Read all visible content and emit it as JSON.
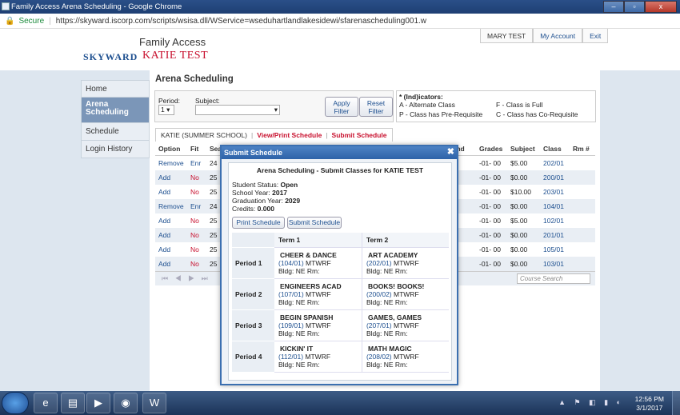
{
  "window": {
    "title": "Family Access Arena Scheduling - Google Chrome",
    "min": "–",
    "max": "▫",
    "close": "x"
  },
  "address": {
    "secure": "Secure",
    "url": "https://skyward.iscorp.com/scripts/wsisa.dll/WService=wseduhartlandlakesidewi/sfarenascheduling001.w"
  },
  "header": {
    "logo": "SKYWARD",
    "app_name": "Family Access",
    "student_name": "KATIE TEST",
    "user": "MARY TEST",
    "my_account": "My Account",
    "exit": "Exit"
  },
  "sidebar": {
    "items": [
      {
        "label": "Home"
      },
      {
        "label": "Arena Scheduling"
      },
      {
        "label": "Schedule"
      },
      {
        "label": "Login History"
      }
    ]
  },
  "page": {
    "title": "Arena Scheduling"
  },
  "filter": {
    "period_label": "Period:",
    "period_value": "1",
    "subject_label": "Subject:",
    "subject_value": "",
    "apply": "Apply Filter",
    "reset": "Reset Filter"
  },
  "indicators": {
    "title": "* (Ind)icators:",
    "a": "A - Alternate Class",
    "f": "F - Class is Full",
    "p": "P - Class has Pre-Requisite",
    "c": "C - Class has Co-Requisite"
  },
  "tabs": {
    "student": "KATIE (SUMMER SCHOOL)",
    "view_print": "View/Print Schedule",
    "separator": "|",
    "submit": "Submit Schedule"
  },
  "grid": {
    "headers": {
      "option": "Option",
      "fit": "Fit",
      "seats": "Sea",
      "ind": "Ind",
      "grades": "Grades",
      "subject": "Subject",
      "class": "Class",
      "rm": "Rm #"
    },
    "rows": [
      {
        "option": "Remove",
        "fit": "Enr",
        "seats": "24",
        "grades": "-01- 00",
        "subject": "$5.00",
        "class": "202/01"
      },
      {
        "option": "Add",
        "fit": "No",
        "seats": "25",
        "grades": "-01- 00",
        "subject": "$0.00",
        "class": "200/01"
      },
      {
        "option": "Add",
        "fit": "No",
        "seats": "25",
        "grades": "-01- 00",
        "subject": "$10.00",
        "class": "203/01"
      },
      {
        "option": "Remove",
        "fit": "Enr",
        "seats": "24",
        "grades": "-01- 00",
        "subject": "$0.00",
        "class": "104/01"
      },
      {
        "option": "Add",
        "fit": "No",
        "seats": "25",
        "grades": "-01- 00",
        "subject": "$5.00",
        "class": "102/01"
      },
      {
        "option": "Add",
        "fit": "No",
        "seats": "25",
        "grades": "-01- 00",
        "subject": "$0.00",
        "class": "201/01"
      },
      {
        "option": "Add",
        "fit": "No",
        "seats": "25",
        "grades": "-01- 00",
        "subject": "$0.00",
        "class": "105/01"
      },
      {
        "option": "Add",
        "fit": "No",
        "seats": "25",
        "grades": "-01- 00",
        "subject": "$0.00",
        "class": "103/01"
      }
    ],
    "pager": "⏮ ◀ ▶ ⏭",
    "course_search_placeholder": "Course Search"
  },
  "modal": {
    "title": "Submit Schedule",
    "close": "✖",
    "subtitle": "Arena Scheduling - Submit Classes for KATIE TEST",
    "status_label": "Student Status:",
    "status": "Open",
    "year_label": "School Year:",
    "year": "2017",
    "grad_label": "Graduation Year:",
    "grad": "2029",
    "credits_label": "Credits:",
    "credits": "0.000",
    "print_btn": "Print Schedule",
    "submit_btn": "Submit Schedule",
    "term1": "Term 1",
    "term2": "Term 2",
    "periods": [
      {
        "label": "Period 1",
        "t1": {
          "name": "CHEER & DANCE",
          "code": "(104/01)",
          "days": "MTWRF",
          "bldg": "Bldg: NE Rm:"
        },
        "t2": {
          "name": "ART ACADEMY",
          "code": "(202/01)",
          "days": "MTWRF",
          "bldg": "Bldg: NE Rm:"
        }
      },
      {
        "label": "Period 2",
        "t1": {
          "name": "ENGINEERS ACAD",
          "code": "(107/01)",
          "days": "MTWRF",
          "bldg": "Bldg: NE Rm:"
        },
        "t2": {
          "name": "BOOKS! BOOKS!",
          "code": "(200/02)",
          "days": "MTWRF",
          "bldg": "Bldg: NE Rm:"
        }
      },
      {
        "label": "Period 3",
        "t1": {
          "name": "BEGIN SPANISH",
          "code": "(109/01)",
          "days": "MTWRF",
          "bldg": "Bldg: NE Rm:"
        },
        "t2": {
          "name": "GAMES, GAMES",
          "code": "(207/01)",
          "days": "MTWRF",
          "bldg": "Bldg: NE Rm:"
        }
      },
      {
        "label": "Period 4",
        "t1": {
          "name": "KICKIN' IT",
          "code": "(112/01)",
          "days": "MTWRF",
          "bldg": "Bldg: NE Rm:"
        },
        "t2": {
          "name": "MATH MAGIC",
          "code": "(208/02)",
          "days": "MTWRF",
          "bldg": "Bldg: NE Rm:"
        }
      }
    ]
  },
  "taskbar": {
    "time": "12:56 PM",
    "date": "3/1/2017"
  }
}
